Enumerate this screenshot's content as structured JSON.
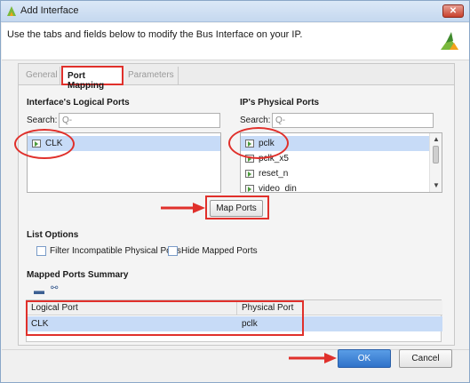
{
  "window": {
    "title": "Add Interface",
    "close_glyph": "✕"
  },
  "header": {
    "description": "Use the tabs and fields below to modify the Bus Interface on your IP."
  },
  "tabs": [
    {
      "label": "General"
    },
    {
      "label": "Port Mapping"
    },
    {
      "label": "Parameters"
    }
  ],
  "logical": {
    "heading": "Interface's Logical Ports",
    "search_label": "Search:",
    "search_placeholder": "Q-",
    "items": [
      "CLK"
    ]
  },
  "physical": {
    "heading": "IP's Physical Ports",
    "search_label": "Search:",
    "search_placeholder": "Q-",
    "items": [
      "pclk",
      "pclk_x5",
      "reset_n",
      "video_din"
    ]
  },
  "map_button": "Map Ports",
  "list_options": {
    "heading": "List Options",
    "filter_label": "Filter Incompatible Physical Ports",
    "hide_label": "Hide Mapped Ports"
  },
  "summary": {
    "heading": "Mapped Ports Summary",
    "columns": [
      "Logical Port",
      "Physical Port"
    ],
    "rows": [
      {
        "logical": "CLK",
        "physical": "pclk"
      }
    ]
  },
  "footer": {
    "ok_label": "OK",
    "cancel_label": "Cancel"
  },
  "colors": {
    "accent_red": "#e0302b",
    "ok_blue": "#3c82d8",
    "selection": "#c7dbf7"
  }
}
